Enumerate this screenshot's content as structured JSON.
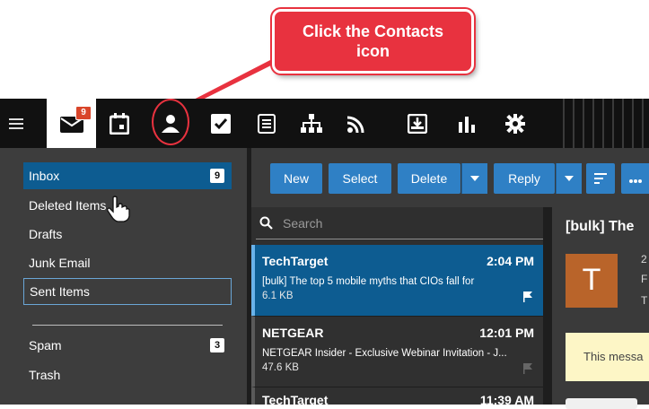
{
  "callout": {
    "line1": "Click the Contacts",
    "line2": "icon"
  },
  "nav": {
    "unread_badge": "9",
    "icons": [
      "menu-icon",
      "mail-icon",
      "calendar-icon",
      "contacts-icon",
      "tasks-icon",
      "notes-icon",
      "org-chart-icon",
      "feeds-icon",
      "archive-icon",
      "reports-icon",
      "settings-icon"
    ]
  },
  "sidebar": {
    "items": [
      {
        "label": "Inbox",
        "count": "9"
      },
      {
        "label": "Deleted Items"
      },
      {
        "label": "Drafts"
      },
      {
        "label": "Junk Email"
      },
      {
        "label": "Sent Items"
      },
      {
        "label": "Spam",
        "count": "3"
      },
      {
        "label": "Trash"
      }
    ]
  },
  "toolbar": {
    "new": "New",
    "select": "Select",
    "delete": "Delete",
    "reply": "Reply"
  },
  "search": {
    "placeholder": "Search"
  },
  "messages": [
    {
      "from": "TechTarget",
      "time": "2:04 PM",
      "subject": "[bulk] The top 5 mobile myths that CIOs fall for",
      "size": "6.1 KB"
    },
    {
      "from": "NETGEAR",
      "time": "12:01 PM",
      "subject": "NETGEAR Insider - Exclusive Webinar Invitation - J...",
      "size": "47.6 KB"
    },
    {
      "from": "TechTarget",
      "time": "11:39 AM"
    }
  ],
  "reading": {
    "title": "[bulk] The",
    "avatar_initial": "T",
    "meta1": "2",
    "meta2": "F",
    "meta3": "T",
    "notice": "This messa"
  },
  "colors": {
    "accent": "#2f80c5",
    "selected": "#0d5c91",
    "callout": "#e8323f",
    "avatar": "#b9642a"
  }
}
